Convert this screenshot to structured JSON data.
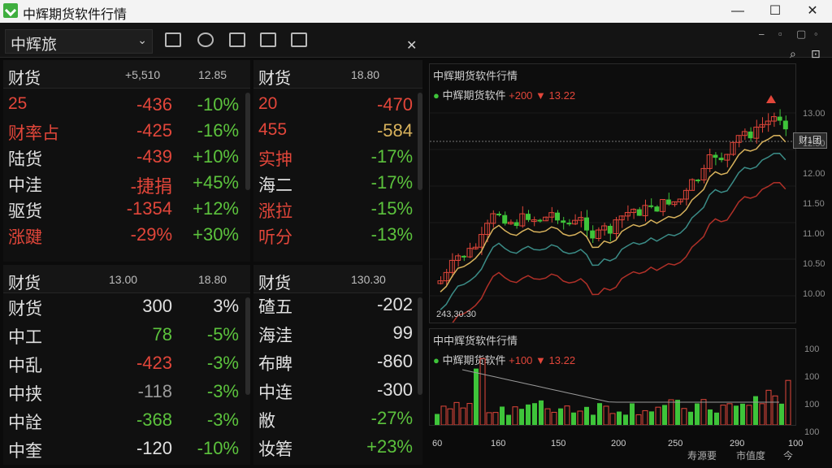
{
  "window": {
    "title": "中辉期货软件行情",
    "minimize": "—",
    "maximize": "☐",
    "close": "✕"
  },
  "toolbar": {
    "selector": "中辉旅",
    "close": "✕"
  },
  "panels": [
    {
      "id": "tl",
      "title": "财货",
      "n1": "+5,510",
      "n2": "12.85",
      "rows": [
        {
          "name": "25",
          "val": "-436",
          "pct": "-10%",
          "nc": "red",
          "vc": "red",
          "pc": "green"
        },
        {
          "name": "财率占",
          "val": "-425",
          "pct": "-16%",
          "nc": "red",
          "vc": "red",
          "pc": "green"
        },
        {
          "name": "陆货",
          "val": "-439",
          "pct": "+10%",
          "nc": "white",
          "vc": "red",
          "pc": "green"
        },
        {
          "name": "中洼",
          "val": "-捷捐",
          "pct": "+45%",
          "nc": "white",
          "vc": "red",
          "pc": "green"
        },
        {
          "name": "驱货",
          "val": "-1354",
          "pct": "+12%",
          "nc": "white",
          "vc": "red",
          "pc": "green"
        },
        {
          "name": "涨踺",
          "val": "-29%",
          "pct": "+30%",
          "nc": "red",
          "vc": "red",
          "pc": "green"
        }
      ]
    },
    {
      "id": "tr",
      "title": "财货",
      "n1": "",
      "n2": "18.80",
      "rows": [
        {
          "name": "20",
          "val": "-470",
          "pct": "",
          "nc": "red",
          "vc": "red",
          "pc": "green"
        },
        {
          "name": "455",
          "val": "-584",
          "pct": "",
          "nc": "red",
          "vc": "yellow",
          "pc": "green"
        },
        {
          "name": "实抻",
          "val": "-17%",
          "pct": "",
          "nc": "red",
          "vc": "green",
          "pc": "green"
        },
        {
          "name": "海二",
          "val": "-17%",
          "pct": "",
          "nc": "white",
          "vc": "green",
          "pc": "green"
        },
        {
          "name": "涨拉",
          "val": "-15%",
          "pct": "",
          "nc": "red",
          "vc": "green",
          "pc": "green"
        },
        {
          "name": "听分",
          "val": "-13%",
          "pct": "",
          "nc": "red",
          "vc": "green",
          "pc": "green"
        }
      ]
    },
    {
      "id": "bl",
      "title": "财货",
      "n1": "13.00",
      "n2": "18.80",
      "rows": [
        {
          "name": "财货",
          "val": "300",
          "pct": "3%",
          "nc": "white",
          "vc": "white",
          "pc": "white"
        },
        {
          "name": "中工",
          "val": "78",
          "pct": "-5%",
          "nc": "white",
          "vc": "green",
          "pc": "green"
        },
        {
          "name": "中乱",
          "val": "-423",
          "pct": "-3%",
          "nc": "white",
          "vc": "red",
          "pc": "green"
        },
        {
          "name": "中挟",
          "val": "-118",
          "pct": "-3%",
          "nc": "white",
          "vc": "grey",
          "pc": "green"
        },
        {
          "name": "中詮",
          "val": "-368",
          "pct": "-3%",
          "nc": "white",
          "vc": "green",
          "pc": "green"
        },
        {
          "name": "中奎",
          "val": "-120",
          "pct": "-10%",
          "nc": "white",
          "vc": "white",
          "pc": "green"
        }
      ]
    },
    {
      "id": "br",
      "title": "财货",
      "n1": "",
      "n2": "130.30",
      "rows": [
        {
          "name": "碴五",
          "val": "-202",
          "pct": "",
          "nc": "white",
          "vc": "white",
          "pc": "green"
        },
        {
          "name": "海洼",
          "val": "99",
          "pct": "",
          "nc": "white",
          "vc": "white",
          "pc": "green"
        },
        {
          "name": "布睥",
          "val": "-860",
          "pct": "",
          "nc": "white",
          "vc": "white",
          "pc": "green"
        },
        {
          "name": "中连",
          "val": "-300",
          "pct": "",
          "nc": "white",
          "vc": "white",
          "pc": "green"
        },
        {
          "name": "敝",
          "val": "-27%",
          "pct": "",
          "nc": "white",
          "vc": "green",
          "pc": "green"
        },
        {
          "name": "妆箬",
          "val": "+23%",
          "pct": "",
          "nc": "white",
          "vc": "green",
          "pc": "green"
        }
      ]
    }
  ],
  "chart": {
    "title": "中辉期货软件行情",
    "legend_name": "中辉期货软件",
    "legend_val1": "+200",
    "legend_val2": "13.22",
    "price_tag": "财1团",
    "low_label": "243,30.30",
    "y_ticks": [
      "13.00",
      "12.50",
      "12.00",
      "11.50",
      "11.00",
      "10.50",
      "10.00"
    ]
  },
  "volume": {
    "title": "中中辉货软件行情",
    "legend_name": "中辉期货软件",
    "legend_val1": "+100",
    "legend_val2": "13.22",
    "x_ticks": [
      "60",
      "160",
      "150",
      "200",
      "250",
      "290",
      "100"
    ],
    "y_ticks": [
      "100",
      "100",
      "100",
      "100"
    ]
  },
  "bottom_tabs": [
    "寿源要",
    "市值度",
    "今"
  ],
  "colors": {
    "up": "#e2463a",
    "down": "#3ec43a",
    "ma1": "#d8b25c",
    "ma2": "#3b8c87",
    "ma3": "#b03028"
  }
}
